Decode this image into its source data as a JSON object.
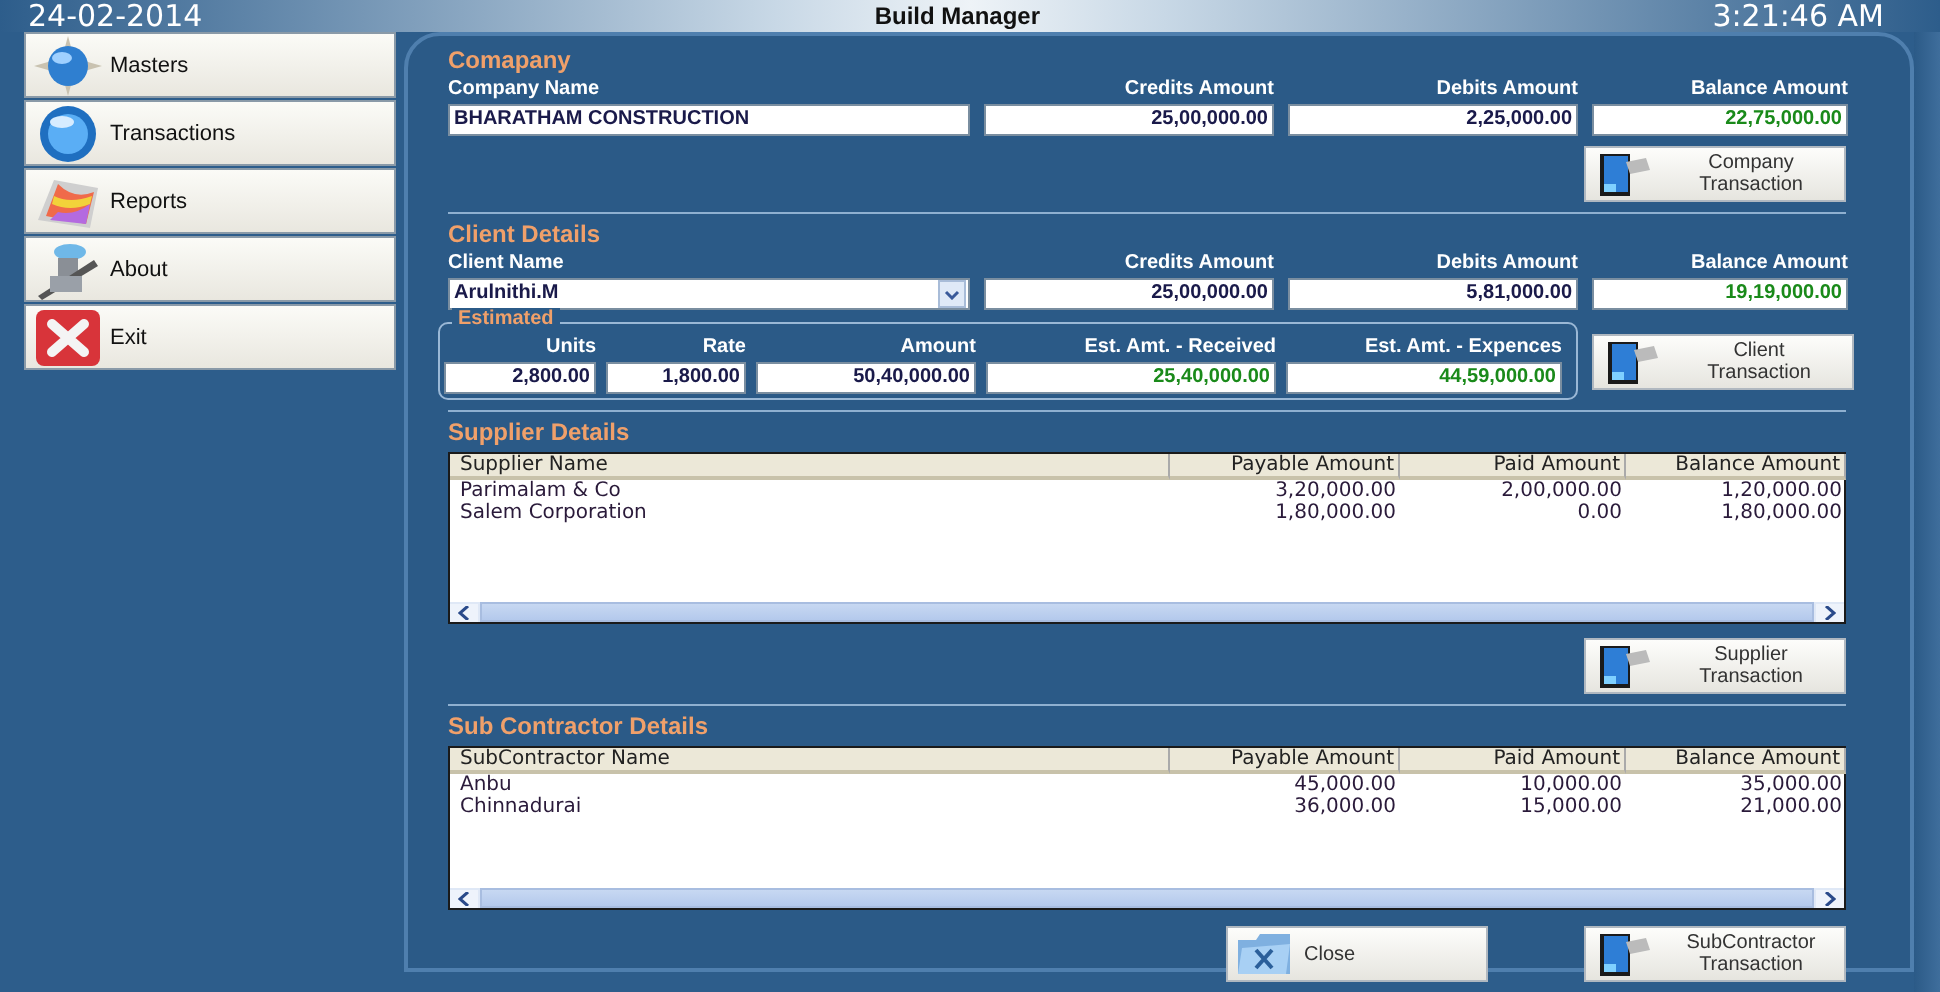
{
  "header": {
    "date": "24-02-2014",
    "title": "Build Manager",
    "time": "3:21:46 AM"
  },
  "menu": [
    {
      "label": "Masters"
    },
    {
      "label": "Transactions"
    },
    {
      "label": "Reports"
    },
    {
      "label": "About"
    },
    {
      "label": "Exit"
    }
  ],
  "company": {
    "title": "Comapany",
    "columns": [
      "Company Name",
      "Credits Amount",
      "Debits Amount",
      "Balance Amount"
    ],
    "values": [
      {
        "value": "BHARATHAM CONSTRUCTION",
        "positive": false
      },
      {
        "value": "25,00,000.00",
        "positive": false
      },
      {
        "value": "2,25,000.00",
        "positive": false
      },
      {
        "value": "22,75,000.00",
        "positive": true
      }
    ],
    "button": [
      "Company",
      "Transaction"
    ]
  },
  "client": {
    "title": "Client Details",
    "columns": [
      "Client Name",
      "Credits Amount",
      "Debits Amount",
      "Balance Amount"
    ],
    "client_name": {
      "value": "Arulnithi.M"
    },
    "values": [
      {
        "value": "25,00,000.00",
        "positive": false
      },
      {
        "value": "5,81,000.00",
        "positive": false
      },
      {
        "value": "19,19,000.00",
        "positive": true
      }
    ],
    "estimated": {
      "title": "Estimated",
      "columns": [
        "Units",
        "Rate",
        "Amount",
        "Est. Amt. - Received",
        "Est. Amt. - Expences"
      ],
      "values": [
        {
          "value": "2,800.00",
          "positive": false
        },
        {
          "value": "1,800.00",
          "positive": false
        },
        {
          "value": "50,40,000.00",
          "positive": false
        },
        {
          "value": "25,40,000.00",
          "positive": true
        },
        {
          "value": "44,59,000.00",
          "positive": true
        }
      ]
    },
    "button": [
      "Client",
      "Transaction"
    ]
  },
  "supplier": {
    "title": "Supplier Details",
    "columns": [
      "Supplier Name",
      "Payable Amount",
      "Paid Amount",
      "Balance Amount"
    ],
    "rows": [
      [
        "Parimalam & Co",
        "3,20,000.00",
        "2,00,000.00",
        "1,20,000.00"
      ],
      [
        "Salem Corporation",
        "1,80,000.00",
        "0.00",
        "1,80,000.00"
      ]
    ],
    "button": [
      "Supplier",
      "Transaction"
    ]
  },
  "subcontractor": {
    "title": "Sub Contractor Details",
    "columns": [
      "SubContractor Name",
      "Payable Amount",
      "Paid Amount",
      "Balance Amount"
    ],
    "rows": [
      [
        "Anbu",
        "45,000.00",
        "10,000.00",
        "35,000.00"
      ],
      [
        "Chinnadurai",
        "36,000.00",
        "15,000.00",
        "21,000.00"
      ]
    ],
    "close_button": "Close",
    "button": [
      "SubContractor",
      "Transaction"
    ]
  }
}
